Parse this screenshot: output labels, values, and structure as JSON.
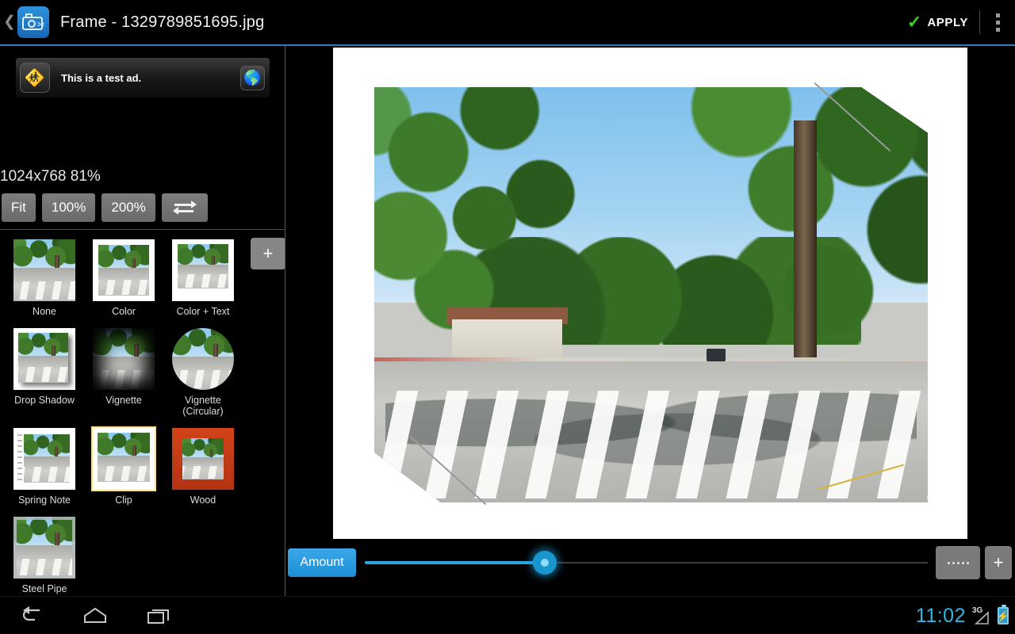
{
  "titlebar": {
    "back_icon": "back-caret-icon",
    "app_icon": "camera-scissors-icon",
    "title": "Frame - 1329789851695.jpg",
    "apply_label": "APPLY",
    "apply_check_color": "#35d419",
    "overflow_icon": "overflow-menu-icon"
  },
  "ad": {
    "text": "This is a test ad.",
    "left_icon": "running-person-icon",
    "right_icon": "globe-icon"
  },
  "zoom": {
    "info": "1024x768 81%",
    "dimensions": "1024x768",
    "percent": "81%",
    "buttons": [
      {
        "label": "Fit"
      },
      {
        "label": "100%"
      },
      {
        "label": "200%"
      }
    ],
    "swap_icon": "swap-arrows-icon"
  },
  "frames": {
    "add_button_label": "+",
    "items": [
      {
        "label": "None",
        "style": "none",
        "selected": false
      },
      {
        "label": "Color",
        "style": "color",
        "selected": false
      },
      {
        "label": "Color + Text",
        "style": "colortext",
        "selected": false
      },
      {
        "label": "Drop Shadow",
        "style": "dropshadow",
        "selected": false
      },
      {
        "label": "Vignette",
        "style": "vignette",
        "selected": false
      },
      {
        "label": "Vignette\n(Circular)",
        "style": "vigcirc",
        "selected": false
      },
      {
        "label": "Spring Note",
        "style": "spring",
        "selected": false
      },
      {
        "label": "Clip",
        "style": "clip",
        "selected": true
      },
      {
        "label": "Wood",
        "style": "wood",
        "selected": false
      },
      {
        "label": "Steel Pipe",
        "style": "steel",
        "selected": false
      }
    ]
  },
  "toolbar": {
    "amount_label": "Amount",
    "slider_percent": 32,
    "slider_accent": "#26a7e0",
    "dots_button": "more-options-icon",
    "plus_button": "+"
  },
  "navbar": {
    "back_icon": "nav-back-icon",
    "home_icon": "nav-home-icon",
    "recent_icon": "nav-recent-apps-icon"
  },
  "status": {
    "time": "11:02",
    "network": "3G",
    "signal_icon": "signal-triangle-icon",
    "battery_icon": "battery-charging-icon",
    "clock_color": "#33b5e5"
  }
}
